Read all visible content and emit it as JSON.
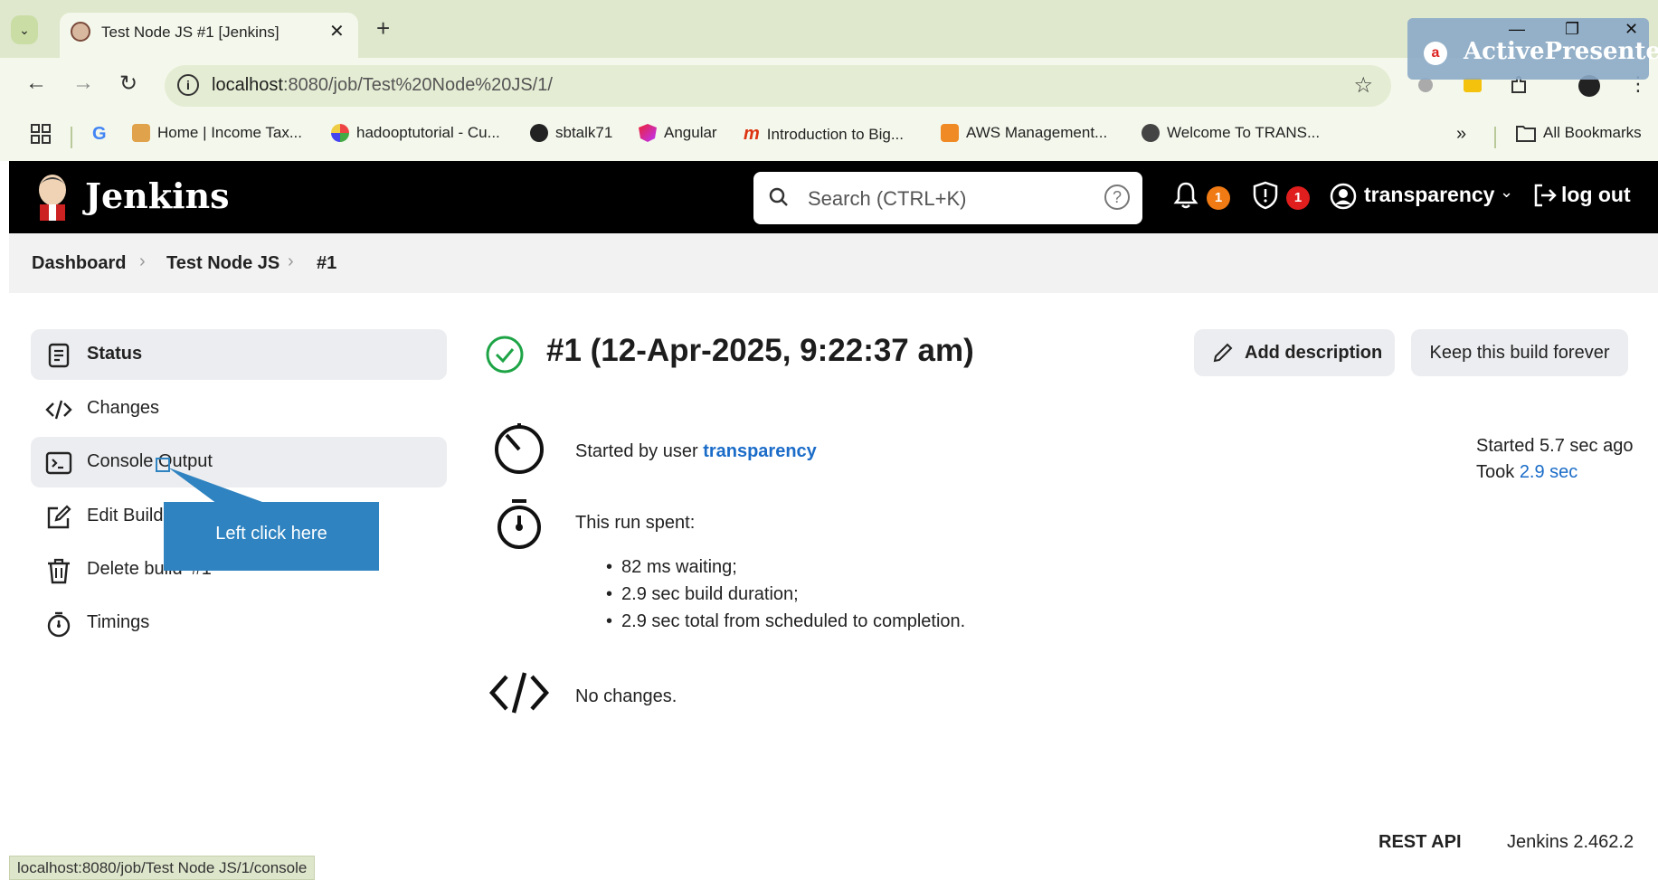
{
  "browser": {
    "tab_title": "Test Node JS #1 [Jenkins]",
    "tab_close": "✕",
    "new_tab": "+",
    "url_host": "localhost",
    "url_path": ":8080/job/Test%20Node%20JS/1/",
    "bookmarks": [
      {
        "label": "G",
        "icon": "google-icon"
      },
      {
        "label": "Home | Income Tax...",
        "icon": "income-tax-icon"
      },
      {
        "label": "hadooptutorial - Cu...",
        "icon": "pinwheel-icon"
      },
      {
        "label": "sbtalk71",
        "icon": "github-icon"
      },
      {
        "label": "Angular",
        "icon": "angular-icon"
      },
      {
        "label": "Introduction to Big...",
        "icon": "m-icon"
      },
      {
        "label": "AWS Management...",
        "icon": "aws-icon"
      },
      {
        "label": "Welcome To TRANS...",
        "icon": "globe-icon"
      }
    ],
    "overflow": "»",
    "all_bookmarks": "All Bookmarks",
    "status_url": "localhost:8080/job/Test Node JS/1/console"
  },
  "overlay": {
    "app_name": "ActivePresenter",
    "logo_letter": "a"
  },
  "header": {
    "brand": "Jenkins",
    "search_placeholder": "Search (CTRL+K)",
    "help": "?",
    "notifications_count": "1",
    "security_count": "1",
    "user": "transparency",
    "logout": "log out",
    "colors": {
      "notification": "#f07a13",
      "security": "#e01e1e"
    }
  },
  "breadcrumb": {
    "items": [
      "Dashboard",
      "Test Node JS",
      "#1"
    ],
    "separator": ">"
  },
  "sidebar": {
    "items": [
      {
        "label": "Status",
        "icon": "document-icon"
      },
      {
        "label": "Changes",
        "icon": "code-icon"
      },
      {
        "label": "Console Output",
        "icon": "terminal-icon"
      },
      {
        "label": "Edit Build Information",
        "icon": "edit-icon"
      },
      {
        "label": "Delete build ‘#1’",
        "icon": "trash-icon"
      },
      {
        "label": "Timings",
        "icon": "stopwatch-icon"
      }
    ]
  },
  "callout": {
    "text": "Left click here"
  },
  "main": {
    "title": "#1 (12-Apr-2025, 9:22:37 am)",
    "add_description": "Add description",
    "keep_forever": "Keep this build forever",
    "started_by_prefix": "Started by user ",
    "started_by_user": "transparency",
    "started_ago": "Started 5.7 sec ago",
    "took_prefix": "Took ",
    "took_value": "2.9 sec",
    "run_spent": "This run spent:",
    "spent_items": [
      "82 ms waiting;",
      "2.9 sec build duration;",
      "2.9 sec total from scheduled to completion."
    ],
    "no_changes": "No changes.",
    "status_color": "#1ea446"
  },
  "footer": {
    "rest_api": "REST API",
    "version": "Jenkins 2.462.2"
  }
}
